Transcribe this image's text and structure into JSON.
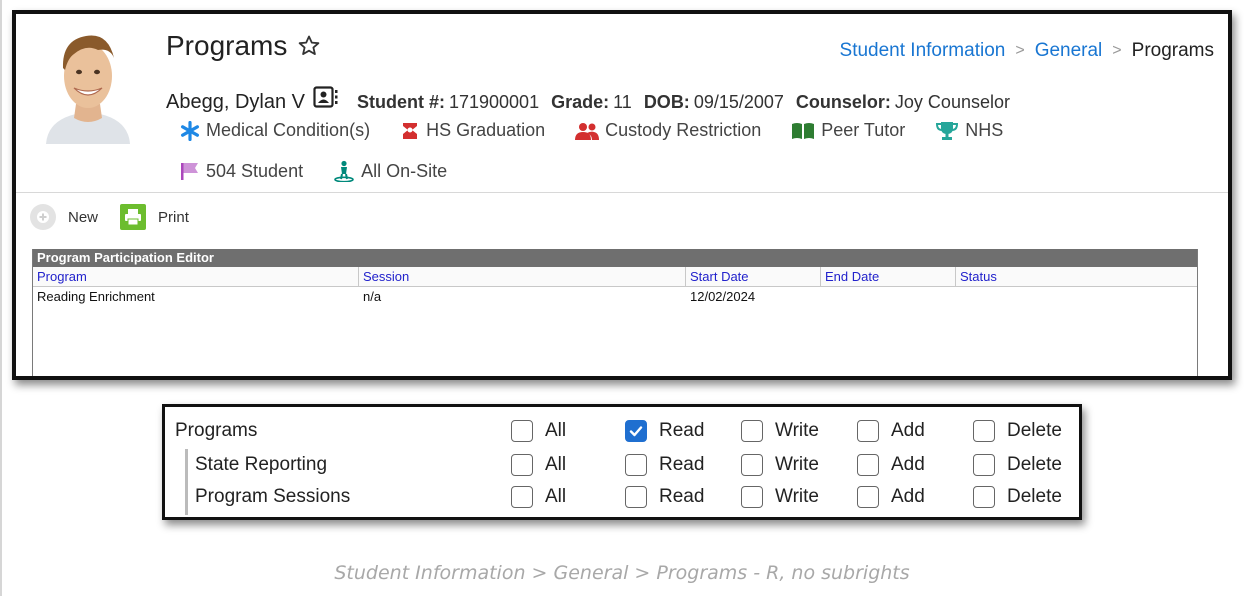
{
  "page": {
    "title": "Programs",
    "breadcrumb": [
      "Student Information",
      "General",
      "Programs"
    ]
  },
  "student": {
    "name": "Abegg, Dylan V",
    "student_num_label": "Student #:",
    "student_num": "171900001",
    "grade_label": "Grade:",
    "grade": "11",
    "dob_label": "DOB:",
    "dob": "09/15/2007",
    "counselor_label": "Counselor:",
    "counselor": "Joy Counselor"
  },
  "flags": [
    {
      "label": "Medical Condition(s)",
      "icon": "asterisk-icon",
      "color": "#1e88e5"
    },
    {
      "label": "HS Graduation",
      "icon": "graduation-cap-icon",
      "color": "#d32f2f"
    },
    {
      "label": "Custody Restriction",
      "icon": "people-icon",
      "color": "#d32f2f"
    },
    {
      "label": "Peer Tutor",
      "icon": "book-icon",
      "color": "#2e7d32"
    },
    {
      "label": "NHS",
      "icon": "trophy-icon",
      "color": "#26a69a"
    },
    {
      "label": "504 Student",
      "icon": "flag-icon",
      "color": "#ab47bc"
    },
    {
      "label": "All On-Site",
      "icon": "person-pin-icon",
      "color": "#00897b"
    }
  ],
  "toolbar": {
    "new_label": "New",
    "print_label": "Print"
  },
  "editor": {
    "title": "Program Participation Editor",
    "columns": [
      "Program",
      "Session",
      "Start Date",
      "End Date",
      "Status"
    ],
    "rows": [
      {
        "program": "Reading Enrichment",
        "session": "n/a",
        "start_date": "12/02/2024",
        "end_date": "",
        "status": ""
      }
    ]
  },
  "rights": {
    "permission_labels": [
      "All",
      "Read",
      "Write",
      "Add",
      "Delete"
    ],
    "tools": [
      {
        "name": "Programs",
        "checked": {
          "all": false,
          "read": true,
          "write": false,
          "add": false,
          "delete": false
        }
      },
      {
        "name": "State Reporting",
        "checked": {
          "all": false,
          "read": false,
          "write": false,
          "add": false,
          "delete": false
        }
      },
      {
        "name": "Program Sessions",
        "checked": {
          "all": false,
          "read": false,
          "write": false,
          "add": false,
          "delete": false
        }
      }
    ]
  },
  "caption": "Student Information > General > Programs - R, no subrights",
  "colors": {
    "link": "#1976d2",
    "header_gray": "#6f6f6f",
    "print_green": "#6cbd2e",
    "checkbox_blue": "#1f6fd0"
  }
}
